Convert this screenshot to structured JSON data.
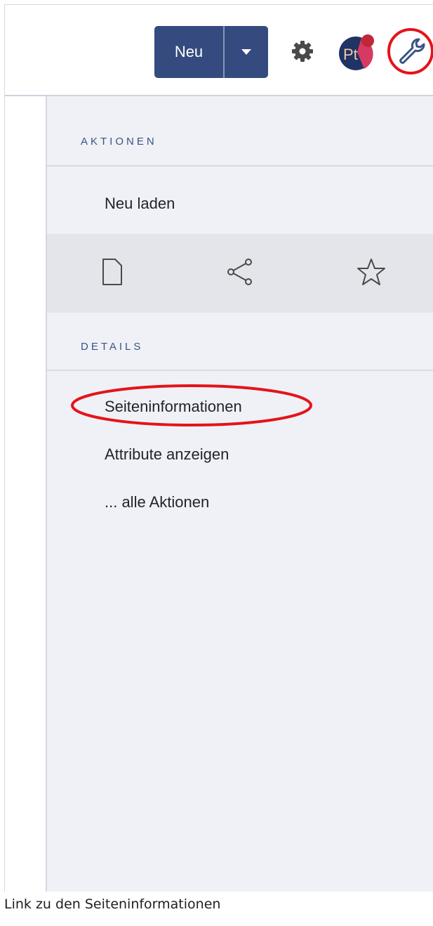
{
  "toolbar": {
    "new_label": "Neu",
    "gear_icon": "gear-icon",
    "avatar_initials": "Pt",
    "avatar_colors": [
      "#1f3364",
      "#d63a63",
      "#c0283a"
    ],
    "tools_icon": "wrench-icon",
    "highlight_color": "#e3141a"
  },
  "panel": {
    "actions_heading": "AKTIONEN",
    "reload_label": "Neu laden",
    "icon_row": [
      "page-icon",
      "share-icon",
      "star-icon"
    ],
    "details_heading": "DETAILS",
    "details_items": [
      "Seiteninformationen",
      "Attribute anzeigen",
      "... alle Aktionen"
    ]
  },
  "caption": "Link zu den Seiteninformationen"
}
